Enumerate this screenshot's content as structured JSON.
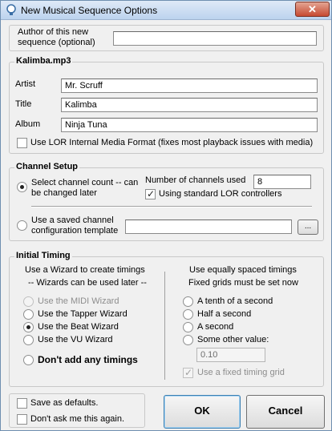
{
  "window": {
    "title": "New Musical Sequence Options",
    "close_label": "✕"
  },
  "author": {
    "label_line1": "Author of this new",
    "label_line2": "sequence (optional)",
    "value": ""
  },
  "media": {
    "group_title": "Kalimba.mp3",
    "artist_label": "Artist",
    "artist_value": "Mr. Scruff",
    "title_label": "Title",
    "title_value": "Kalimba",
    "album_label": "Album",
    "album_value": "Ninja Tuna",
    "lor_format_label": "Use LOR Internal Media Format (fixes most playback issues with media)",
    "lor_format_checked": false
  },
  "channel_setup": {
    "group_title": "Channel Setup",
    "select_count_line1": "Select channel count -- can",
    "select_count_line2": "be changed later",
    "select_count_selected": true,
    "num_channels_label": "Number of channels used",
    "num_channels_value": "8",
    "standard_controllers_label": "Using standard LOR controllers",
    "standard_controllers_checked": true,
    "template_line1": "Use a saved channel",
    "template_line2": "configuration template",
    "template_selected": false,
    "template_value": "",
    "browse_label": "..."
  },
  "timing": {
    "group_title": "Initial Timing",
    "wizard_heading1": "Use a Wizard to create timings",
    "wizard_heading2": "-- Wizards can be used later --",
    "options": [
      {
        "label": "Use the MIDI Wizard",
        "selected": false,
        "disabled": true
      },
      {
        "label": "Use the Tapper Wizard",
        "selected": false,
        "disabled": false
      },
      {
        "label": "Use the Beat Wizard",
        "selected": true,
        "disabled": false
      },
      {
        "label": "Use the VU Wizard",
        "selected": false,
        "disabled": false
      }
    ],
    "no_timings_label": "Don't add any timings",
    "spaced_heading1": "Use equally spaced timings",
    "spaced_heading2": "Fixed grids must be set now",
    "spaced_options": [
      {
        "label": "A tenth of a second",
        "selected": false
      },
      {
        "label": "Half a second",
        "selected": false
      },
      {
        "label": "A second",
        "selected": false
      },
      {
        "label": "Some other value:",
        "selected": false
      }
    ],
    "other_value": "0.10",
    "fixed_grid_label": "Use a fixed timing grid",
    "fixed_grid_checked": true
  },
  "footer": {
    "save_defaults_label": "Save as defaults.",
    "save_defaults_checked": false,
    "dont_ask_label": "Don't ask me this again.",
    "dont_ask_checked": false,
    "ok_label": "OK",
    "cancel_label": "Cancel"
  }
}
